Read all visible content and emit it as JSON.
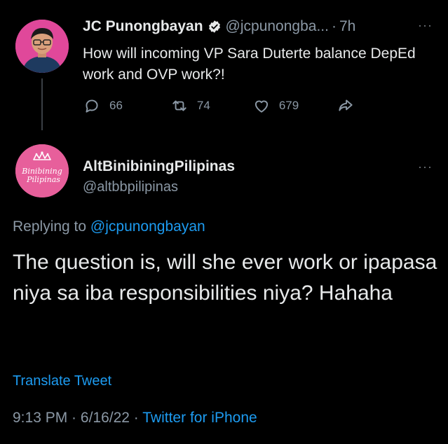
{
  "tweet": {
    "author_name": "JC Punongbayan",
    "author_handle": "@jcpunongba...",
    "separator": "·",
    "time": "7h",
    "more": "···",
    "text": "How will incoming VP Sara Duterte balance DepEd work and OVP work?!",
    "stats": {
      "replies": "66",
      "retweets": "74",
      "likes": "679"
    }
  },
  "reply": {
    "author_name": "AltBinibiningPilipinas",
    "author_handle": "@altbbpilipinas",
    "more": "···",
    "replying_prefix": "Replying to ",
    "replying_to": "@jcpunongbayan",
    "text": "The question is, will she ever work or ipapasa niya sa iba responsibilities niya? Hahaha",
    "translate_label": "Translate Tweet",
    "time": "9:13 PM",
    "dot1": " · ",
    "date": "6/16/22",
    "dot2": " · ",
    "source": "Twitter for iPhone",
    "avatar_logo_text": "Binibining Pilipinas"
  },
  "colors": {
    "background": "#000000",
    "text": "#e7e9ea",
    "muted": "#8b98a5",
    "link": "#1d9bf0",
    "avatar_pink": "#e75f9b"
  }
}
